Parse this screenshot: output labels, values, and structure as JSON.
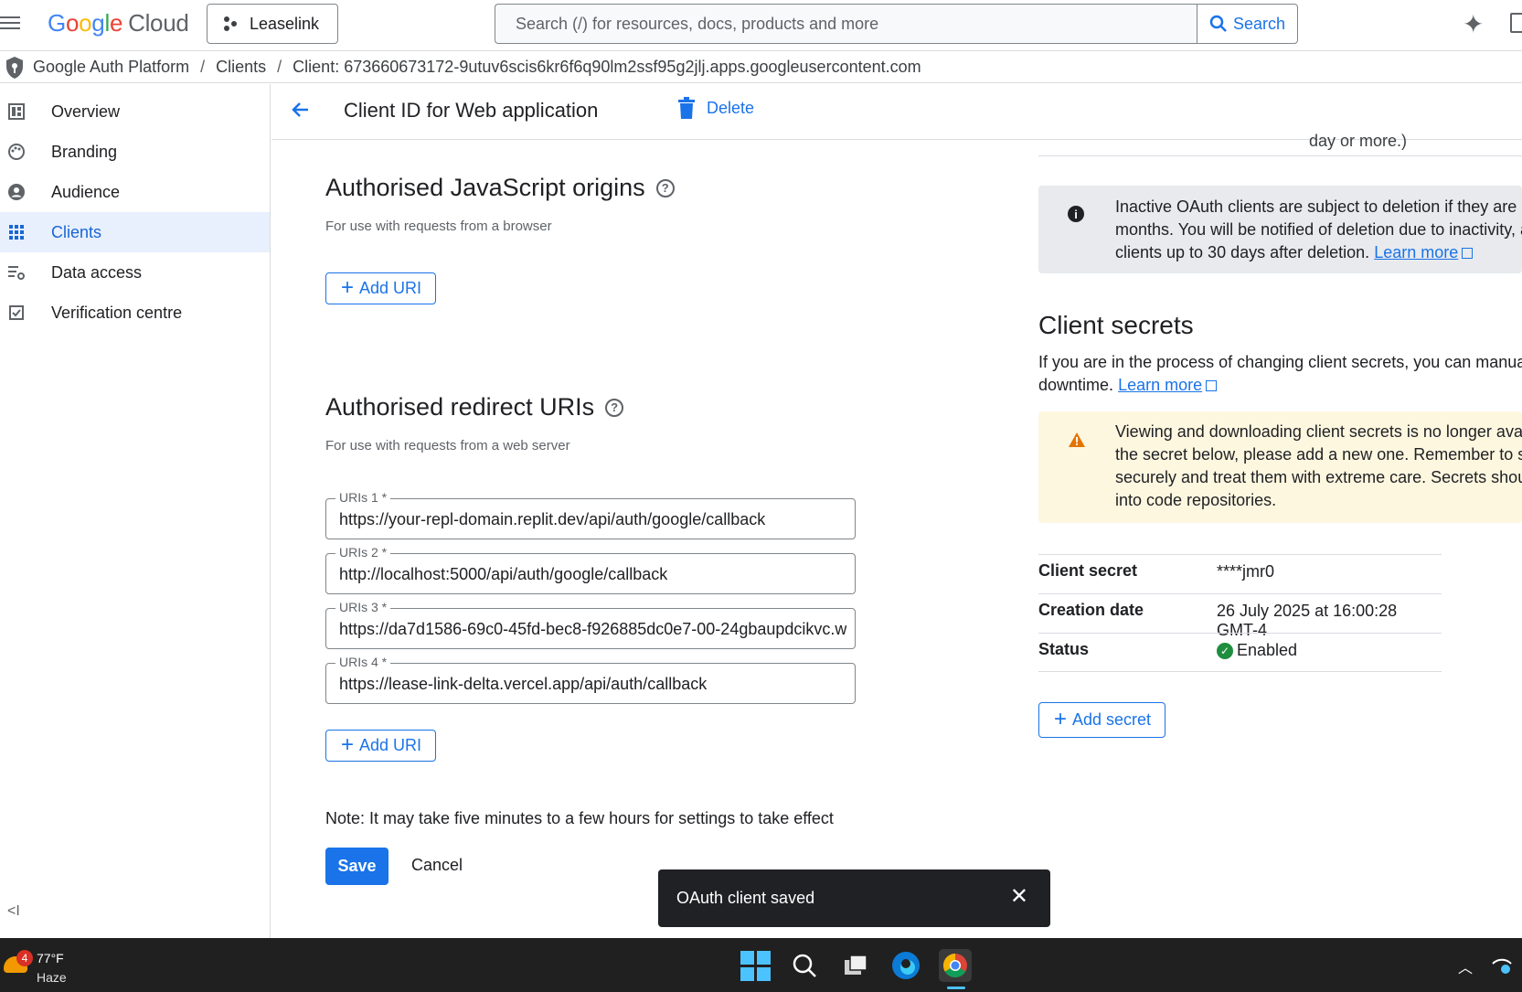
{
  "topbar": {
    "logo_google": [
      "G",
      "o",
      "o",
      "g",
      "l",
      "e"
    ],
    "logo_cloud": "Cloud",
    "project": "Leaselink",
    "search_placeholder": "Search (/) for resources, docs, products and more",
    "search_button": "Search"
  },
  "breadcrumb": {
    "items": [
      "Google Auth Platform",
      "Clients",
      "Client: 673660673172-9utuv6scis6kr6f6q90lm2ssf95g2jlj.apps.googleusercontent.com"
    ],
    "separator": "/"
  },
  "sidebar": {
    "items": [
      {
        "label": "Overview",
        "icon": "dashboard-icon"
      },
      {
        "label": "Branding",
        "icon": "palette-icon"
      },
      {
        "label": "Audience",
        "icon": "person-icon"
      },
      {
        "label": "Clients",
        "icon": "apps-grid-icon",
        "active": true
      },
      {
        "label": "Data access",
        "icon": "data-settings-icon"
      },
      {
        "label": "Verification centre",
        "icon": "checkbox-icon"
      }
    ],
    "collapse_label": "<I"
  },
  "header": {
    "title": "Client ID for Web application",
    "delete_label": "Delete"
  },
  "js_origins": {
    "title": "Authorised JavaScript origins",
    "subtitle": "For use with requests from a browser",
    "add_label": "Add URI"
  },
  "redirect_uris": {
    "title": "Authorised redirect URIs",
    "subtitle": "For use with requests from a web server",
    "fields": [
      {
        "label": "URIs 1 *",
        "value": "https://your-repl-domain.replit.dev/api/auth/google/callback"
      },
      {
        "label": "URIs 2 *",
        "value": "http://localhost:5000/api/auth/google/callback"
      },
      {
        "label": "URIs 3 *",
        "value": "https://da7d1586-69c0-45fd-bec8-f926885dc0e7-00-24gbaupdcikvc.w"
      },
      {
        "label": "URIs 4 *",
        "value": "https://lease-link-delta.vercel.app/api/auth/callback"
      }
    ],
    "add_label": "Add URI"
  },
  "footer": {
    "note": "Note: It may take five minutes to a few hours for settings to take effect",
    "save": "Save",
    "cancel": "Cancel"
  },
  "right": {
    "cut_text": "day or more.)",
    "info_lines": [
      "Inactive OAuth clients are subject to deletion if they are no",
      "months. You will be notified of deletion due to inactivity, a",
      "clients up to 30 days after deletion."
    ],
    "info_link": "Learn more",
    "secrets_title": "Client secrets",
    "secrets_desc_1": "If you are in the process of changing client secrets, you can manually",
    "secrets_desc_2": "downtime.",
    "secrets_link": "Learn more",
    "warn_lines": [
      "Viewing and downloading client secrets is no longer availa",
      "the secret below, please add a new one. Remember to sto",
      "securely and treat them with extreme care. Secrets shoul",
      "into code repositories."
    ],
    "table": [
      {
        "key": "Client secret",
        "value": "****jmr0"
      },
      {
        "key": "Creation date",
        "value": "26 July 2025 at 16:00:28 GMT-4"
      },
      {
        "key": "Status",
        "value": "Enabled"
      }
    ],
    "add_secret": "Add secret"
  },
  "snackbar": {
    "message": "OAuth client saved"
  },
  "taskbar": {
    "weather_badge": "4",
    "temperature": "77°F",
    "condition": "Haze"
  }
}
